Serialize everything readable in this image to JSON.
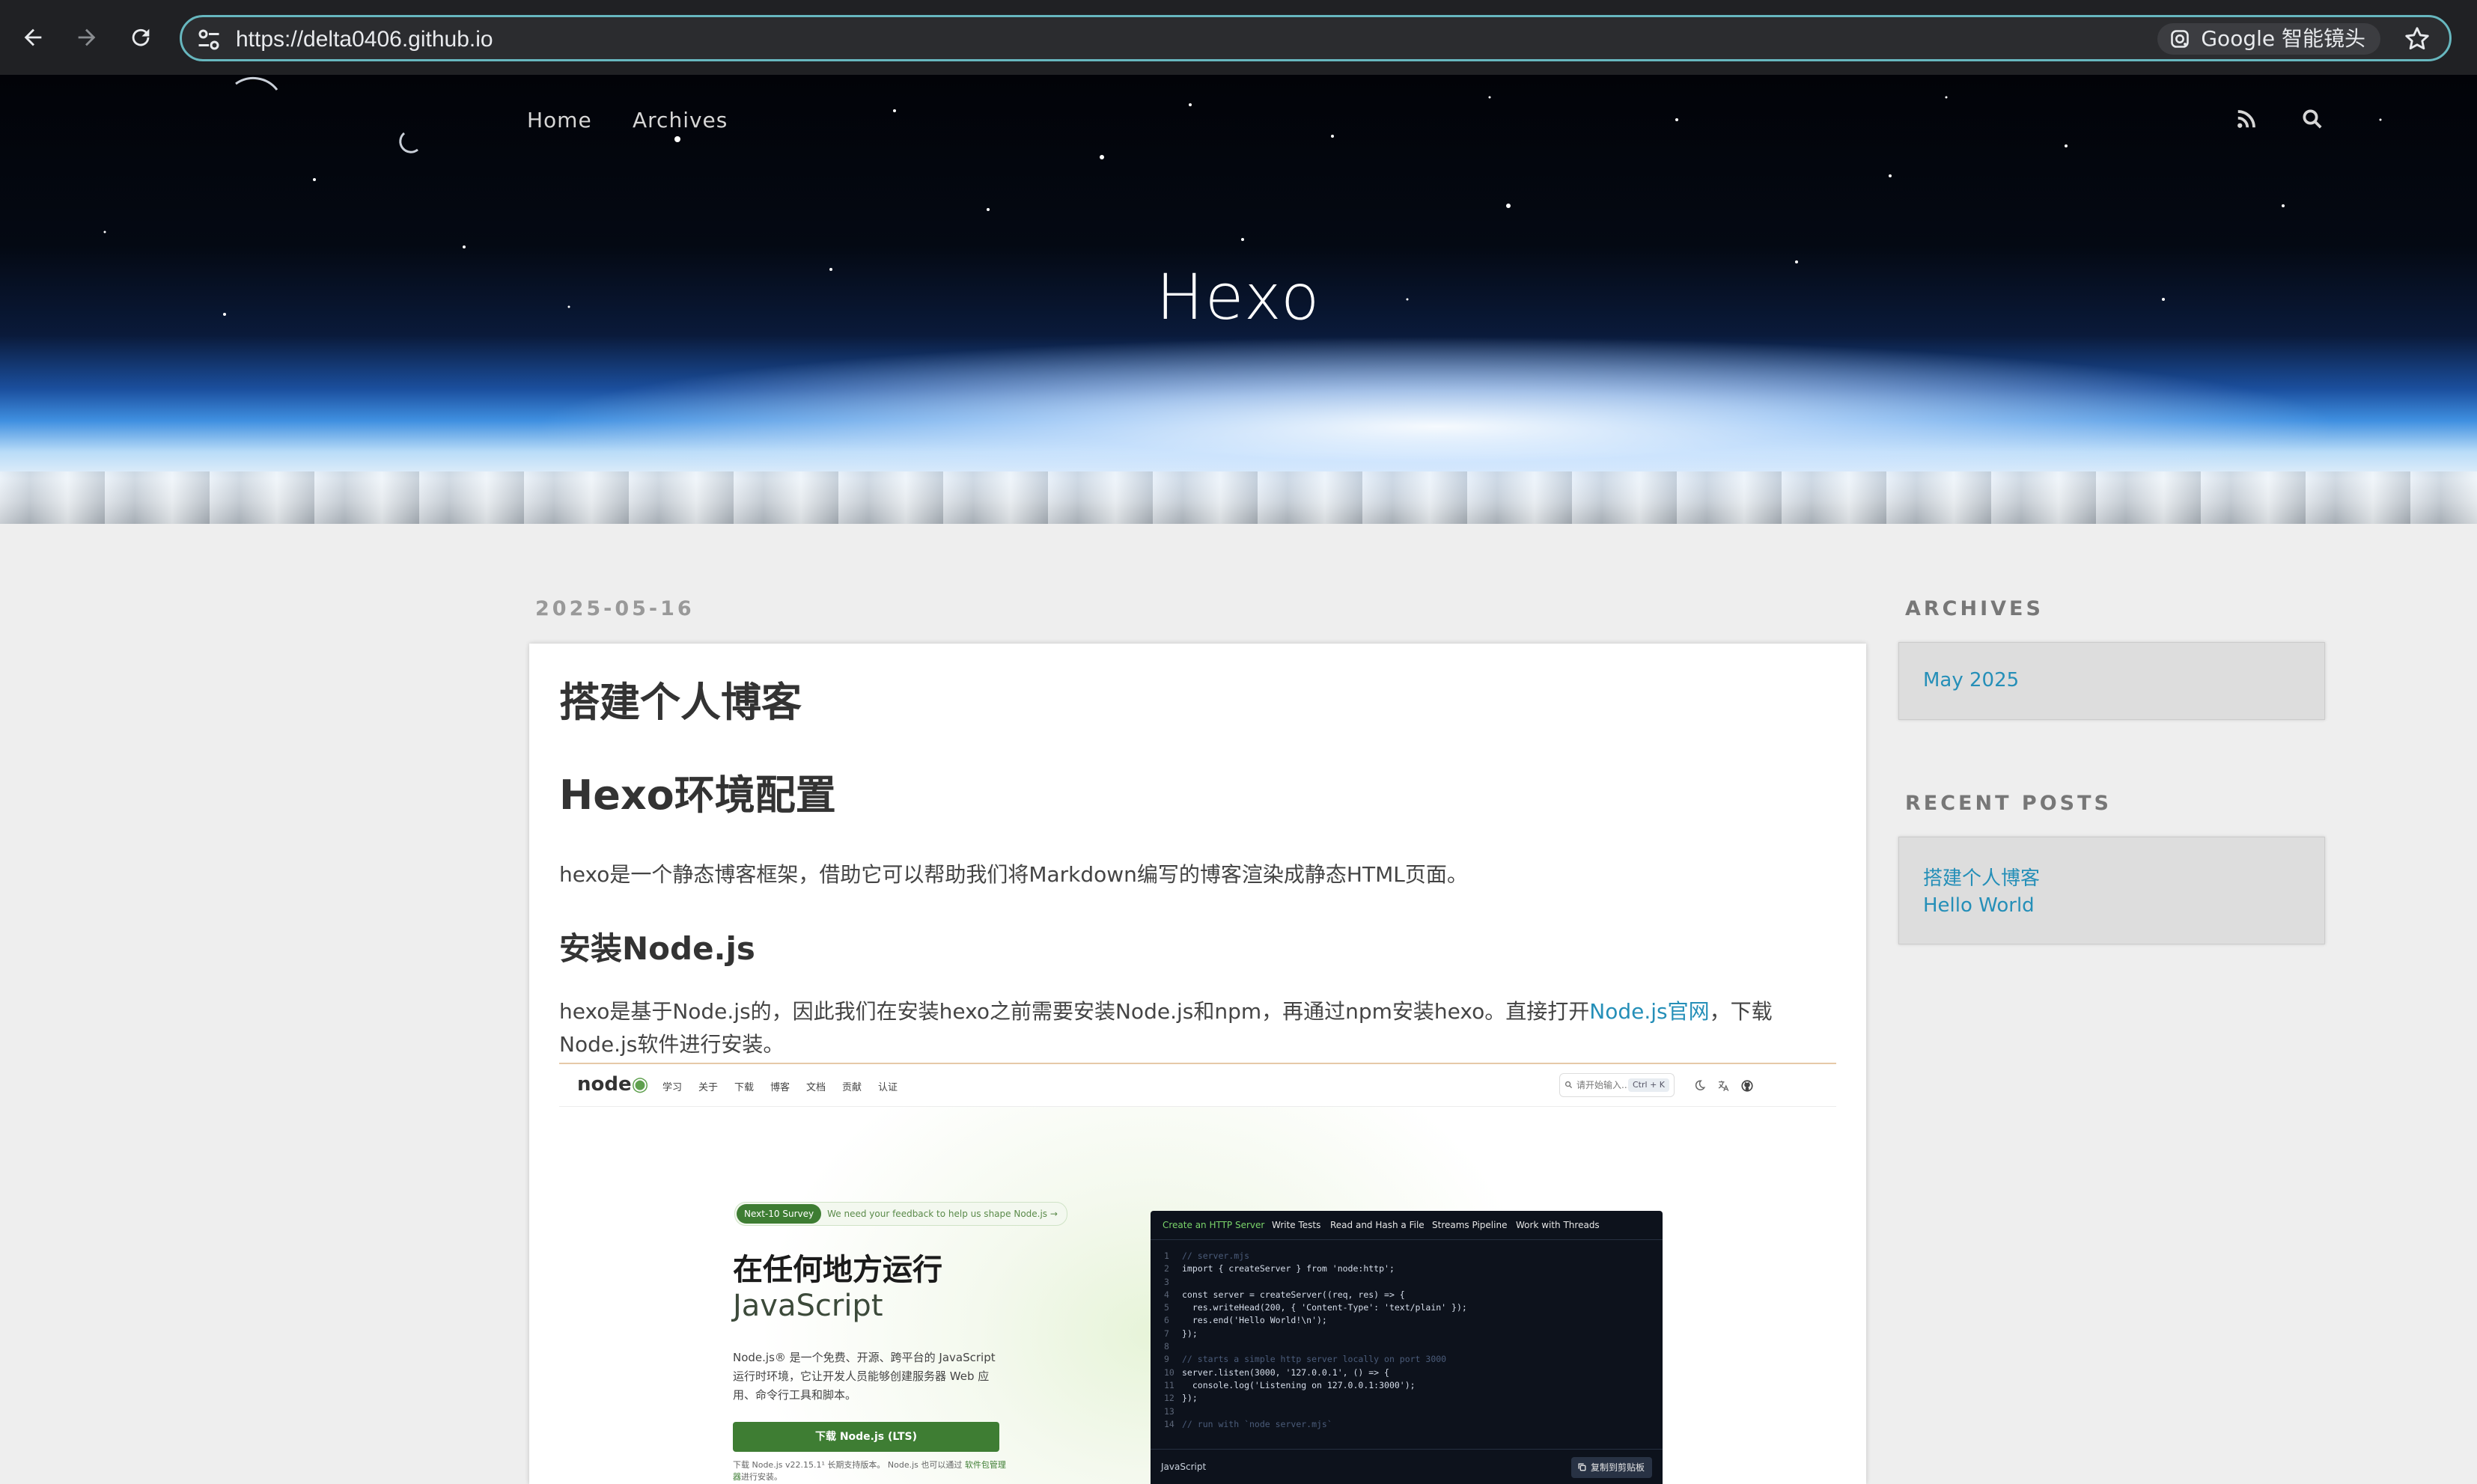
{
  "browser": {
    "url": "https://delta0406.github.io",
    "lens_label": "Google 智能镜头"
  },
  "hero": {
    "title": "Hexo",
    "nav": [
      "Home",
      "Archives"
    ]
  },
  "post": {
    "date": "2025-05-16",
    "title": "搭建个人博客",
    "h1": "Hexo环境配置",
    "p1": "hexo是一个静态博客框架，借助它可以帮助我们将Markdown编写的博客渲染成静态HTML页面。",
    "h2": "安装Node.js",
    "p2_before": "hexo是基于Node.js的，因此我们在安装hexo之前需要安装Node.js和npm，再通过npm安装hexo。直接打开",
    "p2_link": "Node.js官网",
    "p2_after": "，下载Node.js软件进行安装。"
  },
  "nodejs_shot": {
    "logo_text": "node",
    "menu": [
      "学习",
      "关于",
      "下载",
      "博客",
      "文档",
      "贡献",
      "认证"
    ],
    "search_placeholder": "请开始输入...",
    "search_kbd": "Ctrl + K",
    "survey_badge": "Next-10 Survey",
    "survey_text": "We need your feedback to help us shape Node.js →",
    "heading1": "在任何地方运行",
    "heading2": "JavaScript",
    "description": "Node.js® 是一个免费、开源、跨平台的 JavaScript 运行时环境，它让开发人员能够创建服务器 Web 应用、命令行工具和脚本。",
    "download_button": "下载 Node.js (LTS)",
    "download_note_before": "下载 Node.js v22.15.1¹ 长期支持版本。 Node.js 也可以通过",
    "download_note_link": "软件包管理器",
    "download_note_after": "进行安装。",
    "code_tabs": [
      "Create an HTTP Server",
      "Write Tests",
      "Read and Hash a File",
      "Streams Pipeline",
      "Work with Threads"
    ],
    "code_lines": [
      "// server.mjs",
      "import { createServer } from 'node:http';",
      "",
      "const server = createServer((req, res) => {",
      "  res.writeHead(200, { 'Content-Type': 'text/plain' });",
      "  res.end('Hello World!\\n');",
      "});",
      "",
      "// starts a simple http server locally on port 3000",
      "server.listen(3000, '127.0.0.1', () => {",
      "  console.log('Listening on 127.0.0.1:3000');",
      "});",
      "",
      "// run with `node server.mjs`"
    ],
    "code_language": "JavaScript",
    "copy_button": "复制到剪贴板"
  },
  "sidebar": {
    "archives_title": "ARCHIVES",
    "archives": [
      "May 2025"
    ],
    "recent_title": "RECENT POSTS",
    "recent": [
      "搭建个人博客",
      "Hello World"
    ]
  },
  "colors": {
    "link": "#258fb8",
    "node_green": "#3e7d33",
    "omnibox_border": "#67b7bf"
  }
}
